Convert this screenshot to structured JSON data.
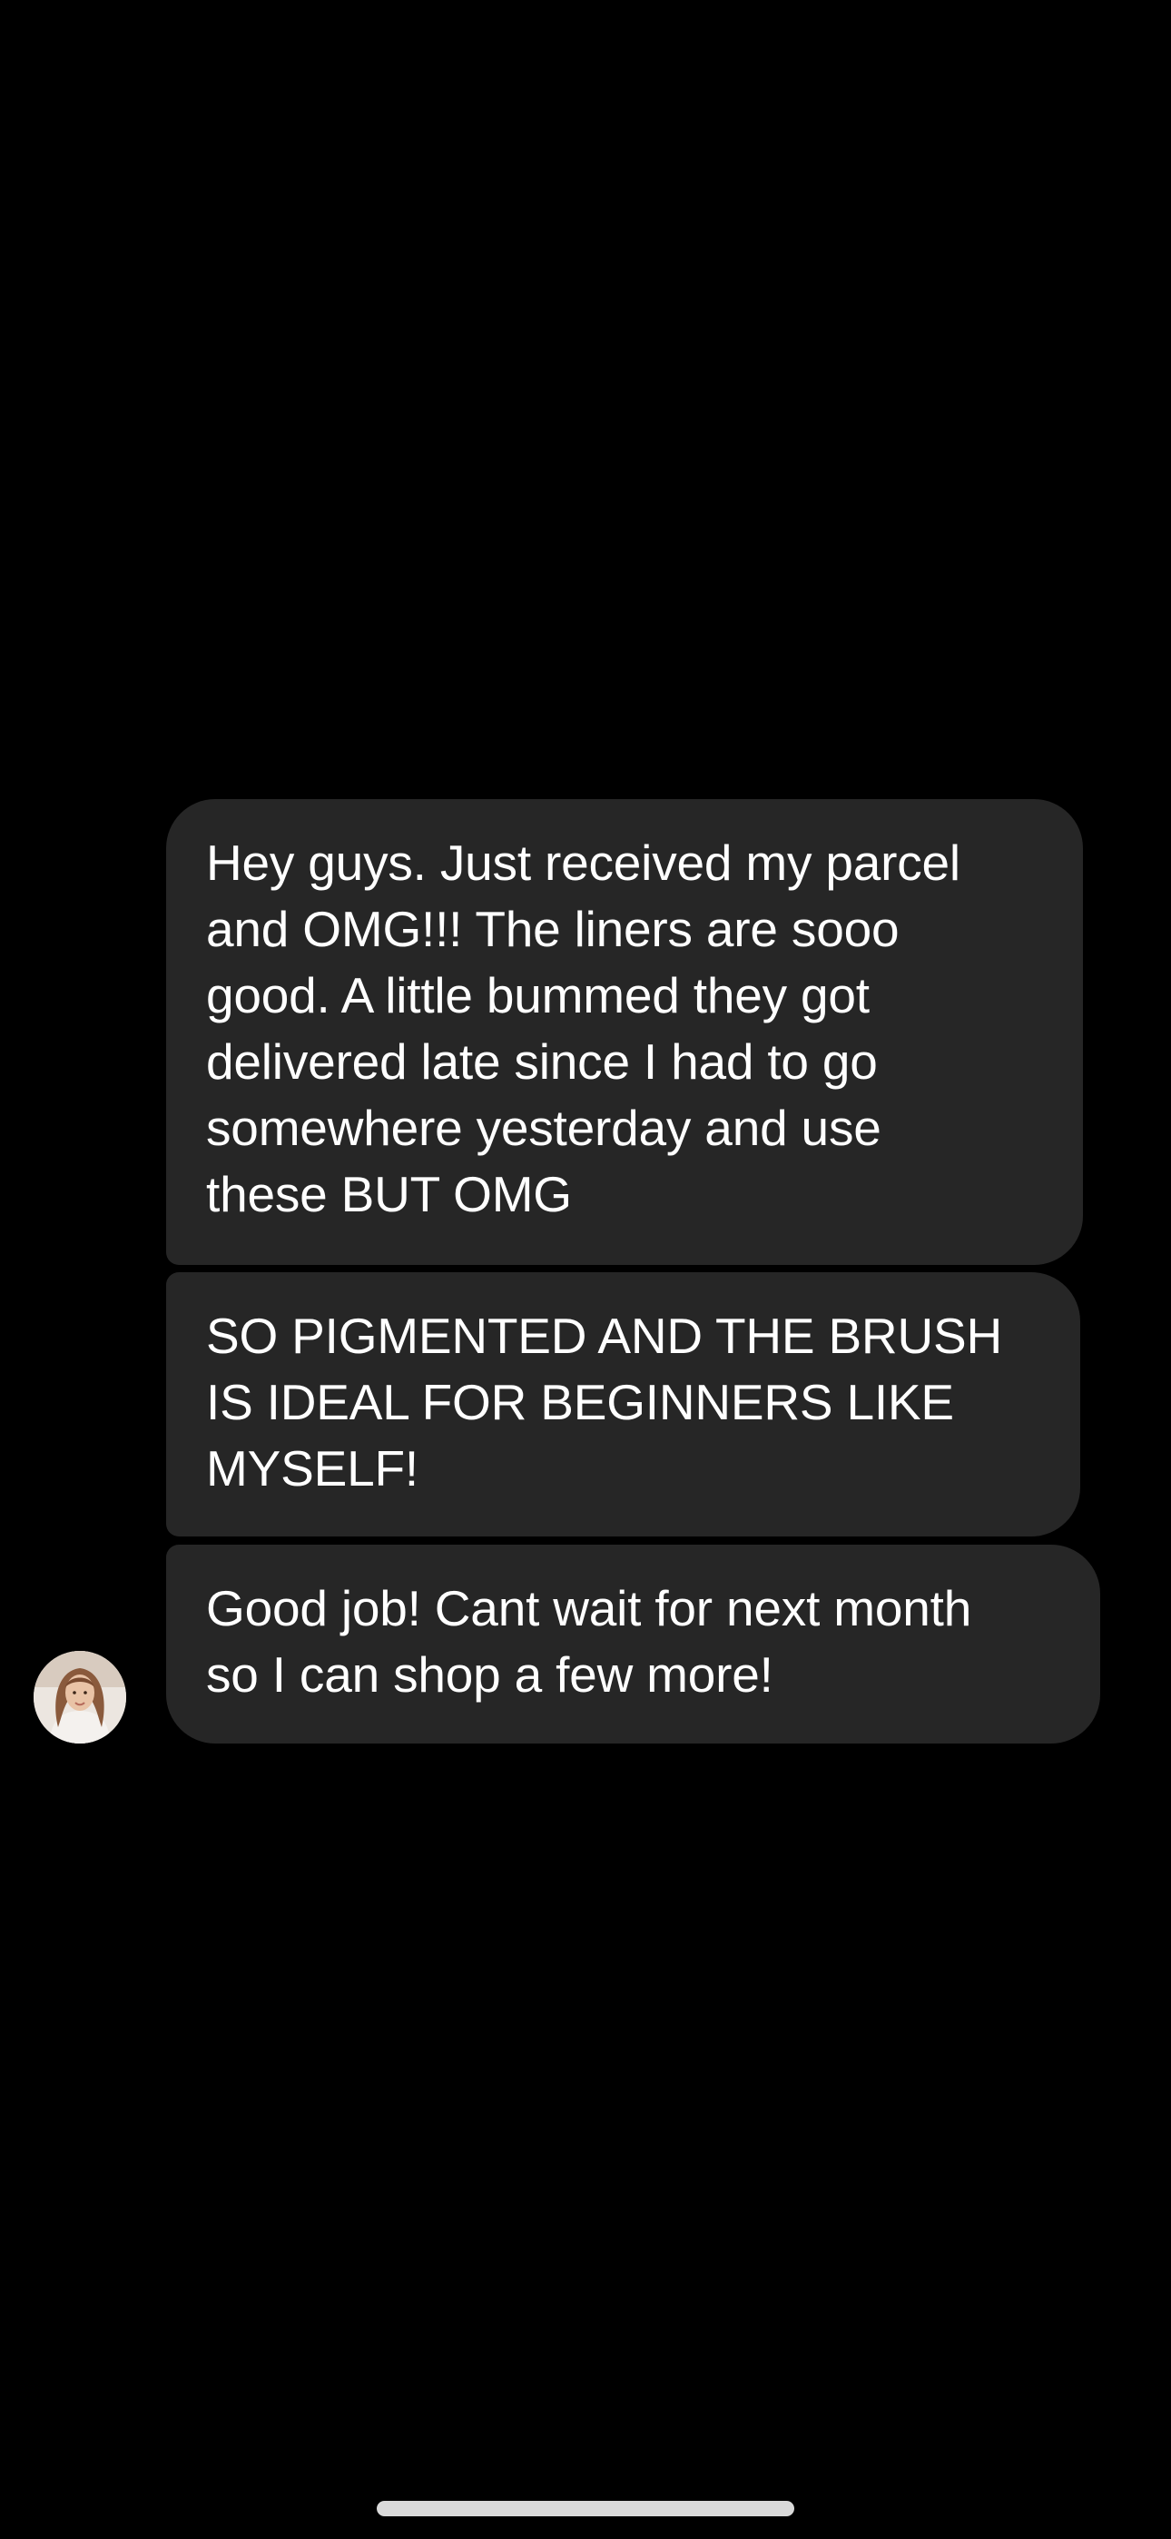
{
  "conversation": {
    "messages": [
      {
        "text": "Hey guys. Just received my parcel\nand OMG!!! The liners are sooo\ngood. A little bummed they got\ndelivered late since I had to go\nsomewhere yesterday and use\nthese BUT OMG"
      },
      {
        "text": "SO PIGMENTED AND THE BRUSH\nIS IDEAL FOR BEGINNERS LIKE\nMYSELF!"
      },
      {
        "text": "Good job! Cant wait for next month\nso I can shop a few more!"
      }
    ],
    "sender_avatar_icon": "profile-photo",
    "bubble_color": "#262626",
    "background_color": "#000000"
  }
}
